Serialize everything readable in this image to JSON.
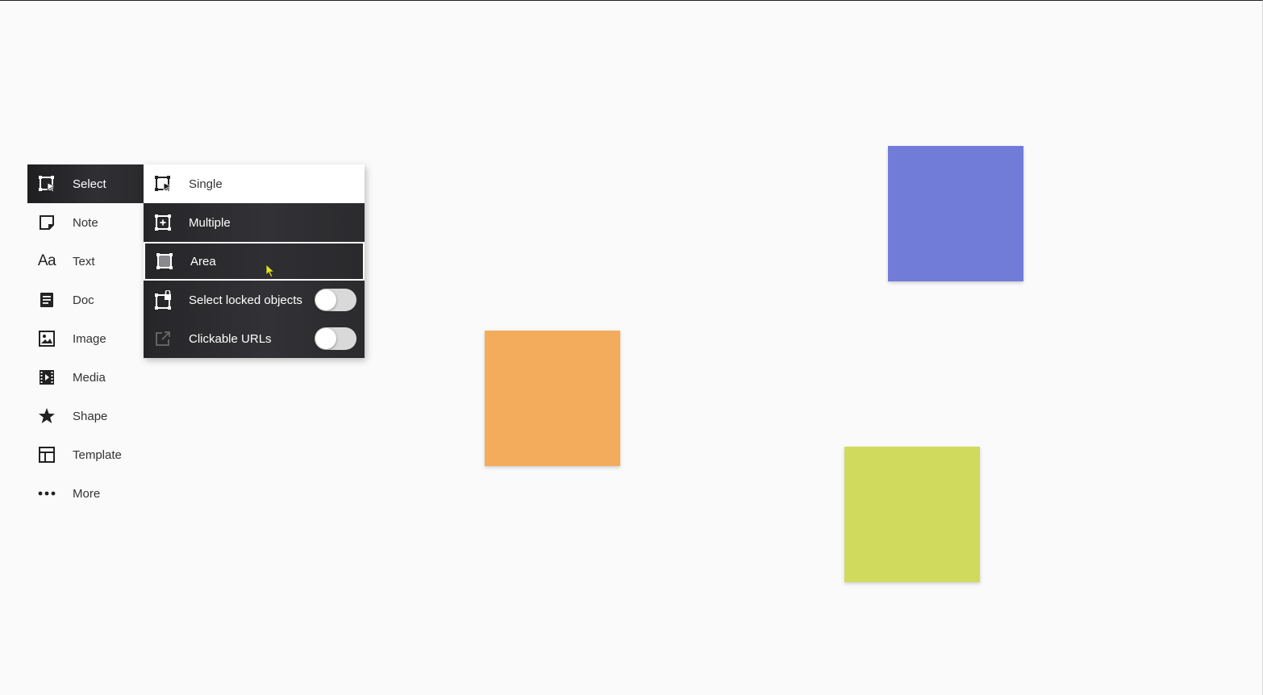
{
  "toolbar": {
    "items": [
      {
        "label": "Select",
        "icon": "select-icon"
      },
      {
        "label": "Note",
        "icon": "note-icon"
      },
      {
        "label": "Text",
        "icon": "text-icon",
        "glyph": "Aa"
      },
      {
        "label": "Doc",
        "icon": "doc-icon"
      },
      {
        "label": "Image",
        "icon": "image-icon"
      },
      {
        "label": "Media",
        "icon": "media-icon"
      },
      {
        "label": "Shape",
        "icon": "star-icon"
      },
      {
        "label": "Template",
        "icon": "template-icon"
      },
      {
        "label": "More",
        "icon": "more-icon"
      }
    ],
    "active": "Select"
  },
  "select_menu": {
    "items": [
      {
        "label": "Single",
        "icon": "single-select-icon"
      },
      {
        "label": "Multiple",
        "icon": "multiple-select-icon"
      },
      {
        "label": "Area",
        "icon": "area-select-icon"
      }
    ],
    "toggles": [
      {
        "label": "Select locked objects",
        "icon": "lock-select-icon",
        "enabled": false
      },
      {
        "label": "Clickable URLs",
        "icon": "external-link-icon",
        "enabled": false
      }
    ]
  },
  "canvas": {
    "notes": [
      {
        "name": "sticky-note-purple",
        "color": "#717bd8"
      },
      {
        "name": "sticky-note-orange",
        "color": "#f2ac5b"
      },
      {
        "name": "sticky-note-lime",
        "color": "#d0da5c"
      }
    ]
  },
  "colors": {
    "toolbar_active_bg": "#2a2a2d",
    "toggle_track": "#d9d9d9",
    "cursor": "#e4e41a"
  }
}
